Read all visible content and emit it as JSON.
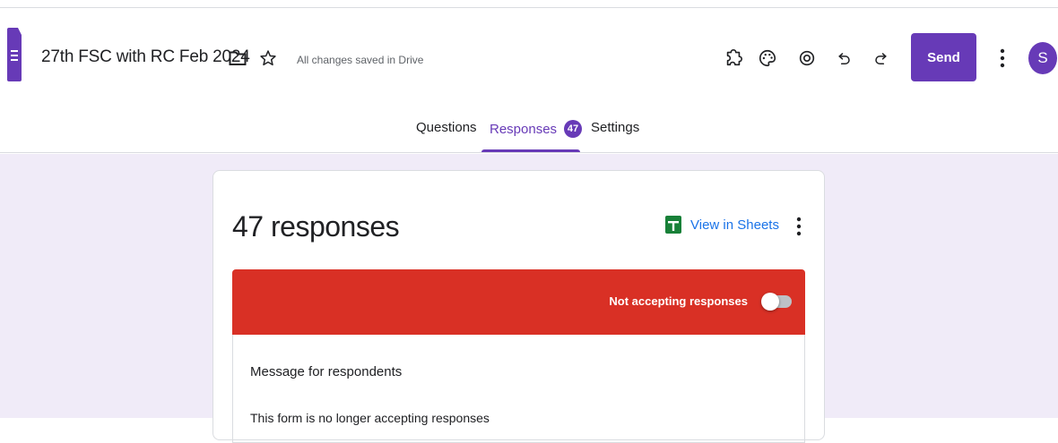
{
  "header": {
    "title": "27th FSC with RC Feb 2024",
    "saved_status": "All changes saved in Drive",
    "send_label": "Send",
    "avatar_initial": "S"
  },
  "tabs": [
    {
      "label": "Questions",
      "active": false
    },
    {
      "label": "Responses",
      "active": true,
      "badge": "47"
    },
    {
      "label": "Settings",
      "active": false
    }
  ],
  "summary": {
    "count_text": "47 responses",
    "view_in_sheets": "View in Sheets"
  },
  "banner": {
    "label": "Not accepting responses",
    "accepting": false
  },
  "message": {
    "heading": "Message for respondents",
    "text": "This form is no longer accepting responses"
  },
  "colors": {
    "brand": "#673ab7",
    "banner_red": "#d93025",
    "link_blue": "#1a73e8",
    "content_bg": "#f0ebf8",
    "sheets_green": "#188038"
  },
  "icons": [
    "forms-logo-icon",
    "folder-icon",
    "star-icon",
    "addon-icon",
    "palette-icon",
    "preview-icon",
    "undo-icon",
    "redo-icon",
    "more-vert-icon",
    "sheets-icon"
  ]
}
